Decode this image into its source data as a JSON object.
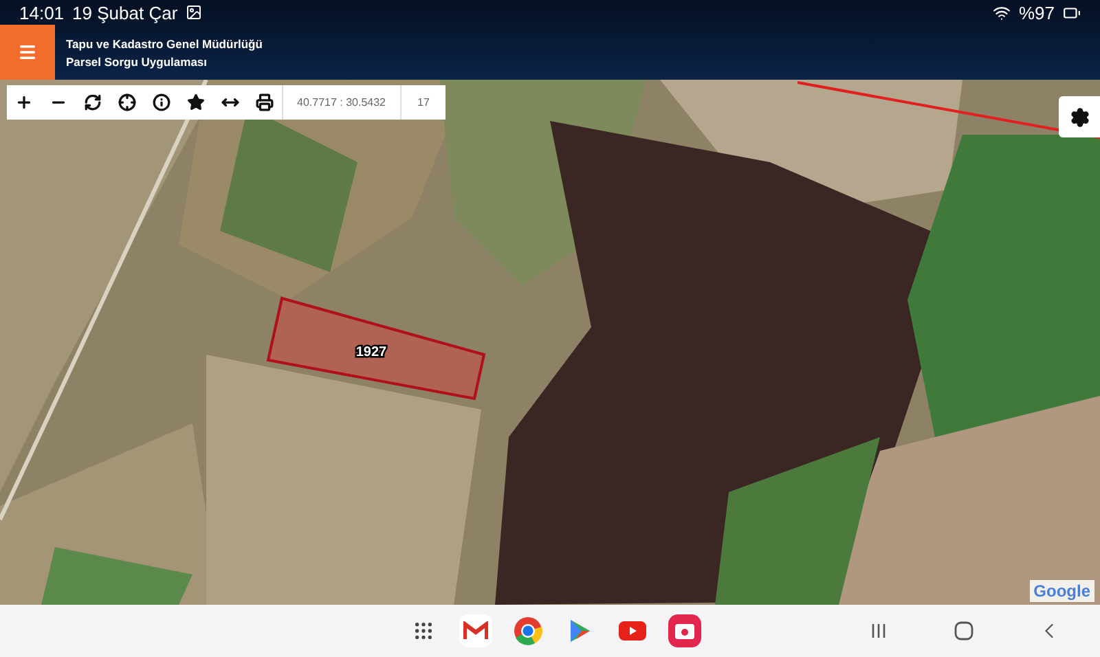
{
  "status_bar": {
    "time": "14:01",
    "date": "19 Şubat Çar",
    "battery": "%97"
  },
  "header": {
    "title": "Tapu ve Kadastro Genel Müdürlüğü",
    "subtitle": "Parsel Sorgu Uygulaması"
  },
  "toolbar": {
    "tools": [
      {
        "kind": "zoom-in"
      },
      {
        "kind": "zoom-out"
      },
      {
        "kind": "refresh"
      },
      {
        "kind": "locate"
      },
      {
        "kind": "info"
      },
      {
        "kind": "favorite"
      },
      {
        "kind": "measure"
      },
      {
        "kind": "print"
      }
    ],
    "coordinates": "40.7717 : 30.5432",
    "zoom": "17"
  },
  "map": {
    "parcel": {
      "label": "1927"
    },
    "attribution": "Google"
  },
  "taskbar": {
    "apps": [
      {
        "kind": "apps"
      },
      {
        "kind": "mail"
      },
      {
        "kind": "browser"
      },
      {
        "kind": "store"
      },
      {
        "kind": "video"
      },
      {
        "kind": "camera"
      }
    ],
    "nav": [
      {
        "kind": "recents"
      },
      {
        "kind": "home"
      },
      {
        "kind": "back"
      }
    ]
  }
}
